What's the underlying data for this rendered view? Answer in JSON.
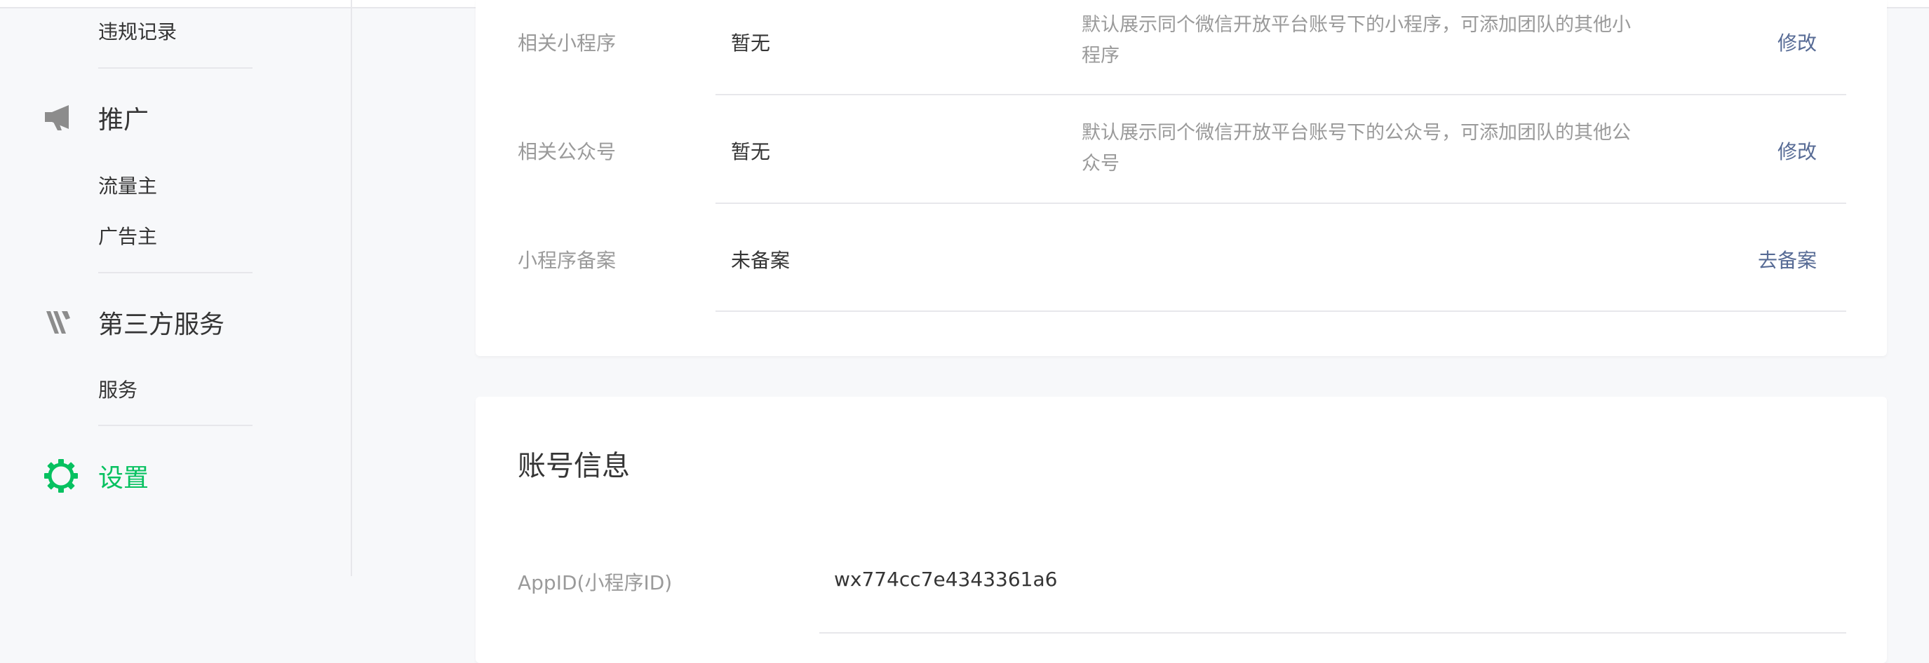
{
  "sidebar": {
    "violations_label": "违规记录",
    "promotion": {
      "label": "推广",
      "icon": "megaphone-icon",
      "items": [
        "流量主",
        "广告主"
      ]
    },
    "third_party": {
      "label": "第三方服务",
      "icon": "third-party-icon",
      "items": [
        "服务"
      ]
    },
    "settings": {
      "label": "设置",
      "icon": "gear-icon",
      "active_color": "#07c160"
    }
  },
  "related": {
    "rows": [
      {
        "label": "相关小程序",
        "value": "暂无",
        "desc_line1": "默认展示同个微信开放平台账号下的小程序，可添加团队的其他小",
        "desc_line2": "程序",
        "action": "修改"
      },
      {
        "label": "相关公众号",
        "value": "暂无",
        "desc_line1": "默认展示同个微信开放平台账号下的公众号，可添加团队的其他公",
        "desc_line2": "众号",
        "action": "修改"
      },
      {
        "label": "小程序备案",
        "value": "未备案",
        "desc_line1": "",
        "desc_line2": "",
        "action": "去备案"
      }
    ]
  },
  "account": {
    "title": "账号信息",
    "appid_label": "AppID(小程序ID)",
    "appid_value": "wx774cc7e4343361a6"
  },
  "colors": {
    "link": "#576b95",
    "accent": "#07c160",
    "muted_text": "#9a9a9a"
  }
}
